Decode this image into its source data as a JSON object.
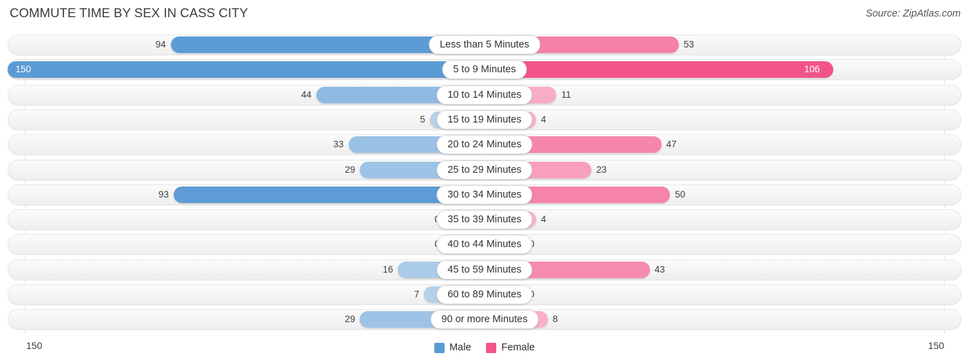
{
  "header": {
    "title": "COMMUTE TIME BY SEX IN CASS CITY",
    "source": "Source: ZipAtlas.com"
  },
  "axis": {
    "left_label": "150",
    "right_label": "150"
  },
  "legend": {
    "items": [
      {
        "label": "Male",
        "color": "#5b9bd5"
      },
      {
        "label": "Female",
        "color": "#f2548a"
      }
    ]
  },
  "chart_data": {
    "type": "bar",
    "title": "COMMUTE TIME BY SEX IN CASS CITY",
    "subtitle": "Source: ZipAtlas.com",
    "orientation": "horizontal-diverging",
    "xlabel": "",
    "ylabel": "",
    "xlim": [
      150,
      150
    ],
    "grid": true,
    "legend_position": "bottom-center",
    "categories": [
      "Less than 5 Minutes",
      "5 to 9 Minutes",
      "10 to 14 Minutes",
      "15 to 19 Minutes",
      "20 to 24 Minutes",
      "25 to 29 Minutes",
      "30 to 34 Minutes",
      "35 to 39 Minutes",
      "40 to 44 Minutes",
      "45 to 59 Minutes",
      "60 to 89 Minutes",
      "90 or more Minutes"
    ],
    "series": [
      {
        "name": "Male",
        "color": "#5b9bd5",
        "side": "left",
        "values": [
          94,
          150,
          44,
          5,
          33,
          29,
          93,
          0,
          0,
          16,
          7,
          29
        ]
      },
      {
        "name": "Female",
        "color": "#f2548a",
        "side": "right",
        "values": [
          53,
          106,
          11,
          4,
          47,
          23,
          50,
          4,
          0,
          43,
          0,
          8
        ]
      }
    ]
  }
}
